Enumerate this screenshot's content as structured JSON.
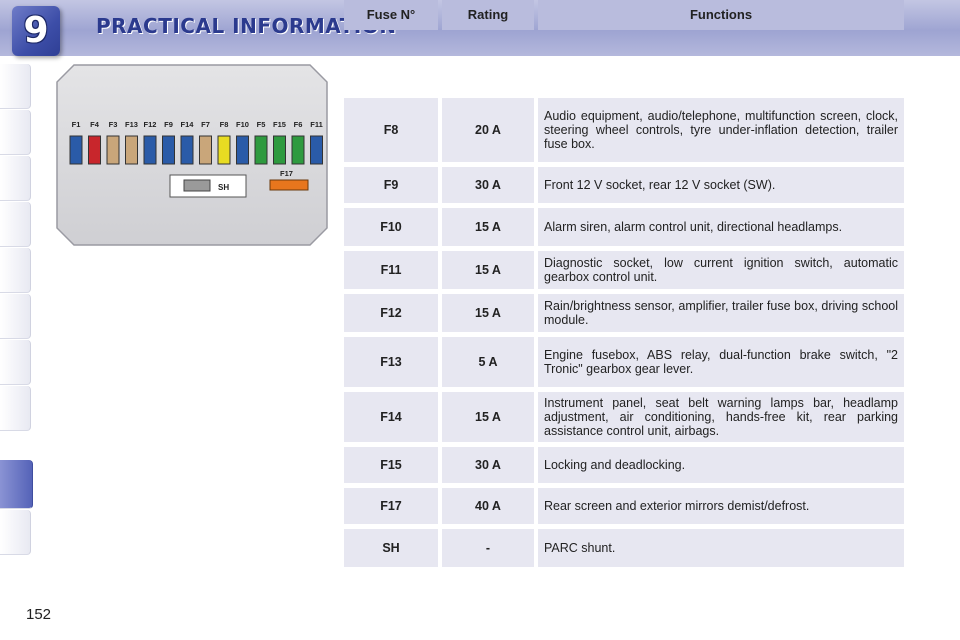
{
  "header": {
    "chapter_number": "9",
    "title": "PRACTICAL INFORMATION"
  },
  "page_number": "152",
  "diagram": {
    "fuse_labels": [
      "F1",
      "F4",
      "F3",
      "F13",
      "F12",
      "F9",
      "F14",
      "F7",
      "F8",
      "F10",
      "F5",
      "F15",
      "F6",
      "F11"
    ],
    "fuse_colors": [
      "#2a5ba8",
      "#c8262c",
      "#c9a67a",
      "#c9a67a",
      "#2a5ba8",
      "#2a5ba8",
      "#2a5ba8",
      "#c9a67a",
      "#e8dc22",
      "#2a5ba8",
      "#2e9a3f",
      "#2e9a3f",
      "#2e9a3f",
      "#2a5ba8"
    ],
    "shunt_label": "SH",
    "f17_label": "F17",
    "f17_color": "#e8761d"
  },
  "table": {
    "headers": {
      "fuse": "Fuse N°",
      "rating": "Rating",
      "functions": "Functions"
    },
    "rows": [
      {
        "fuse": "F8",
        "rating": "20 A",
        "functions": "Audio equipment, audio/telephone, multifunction screen, clock, steering wheel controls, tyre under-inflation detection, trailer fuse box."
      },
      {
        "fuse": "F9",
        "rating": "30 A",
        "functions": "Front 12 V socket, rear 12 V socket (SW)."
      },
      {
        "fuse": "F10",
        "rating": "15 A",
        "functions": "Alarm siren, alarm control unit, directional headlamps."
      },
      {
        "fuse": "F11",
        "rating": "15 A",
        "functions": "Diagnostic socket, low current ignition switch, automatic gearbox control unit."
      },
      {
        "fuse": "F12",
        "rating": "15 A",
        "functions": "Rain/brightness sensor, amplifier, trailer fuse box, driving school module."
      },
      {
        "fuse": "F13",
        "rating": "5 A",
        "functions": "Engine fusebox, ABS relay, dual-function brake switch, \"2 Tronic\" gearbox gear lever."
      },
      {
        "fuse": "F14",
        "rating": "15 A",
        "functions": "Instrument panel, seat belt warning lamps bar, headlamp adjustment, air conditioning, hands-free kit, rear parking assistance control unit, airbags."
      },
      {
        "fuse": "F15",
        "rating": "30 A",
        "functions": "Locking and deadlocking."
      },
      {
        "fuse": "F17",
        "rating": "40 A",
        "functions": "Rear screen and exterior mirrors demist/defrost."
      },
      {
        "fuse": "SH",
        "rating": "-",
        "functions": "PARC shunt."
      }
    ]
  }
}
